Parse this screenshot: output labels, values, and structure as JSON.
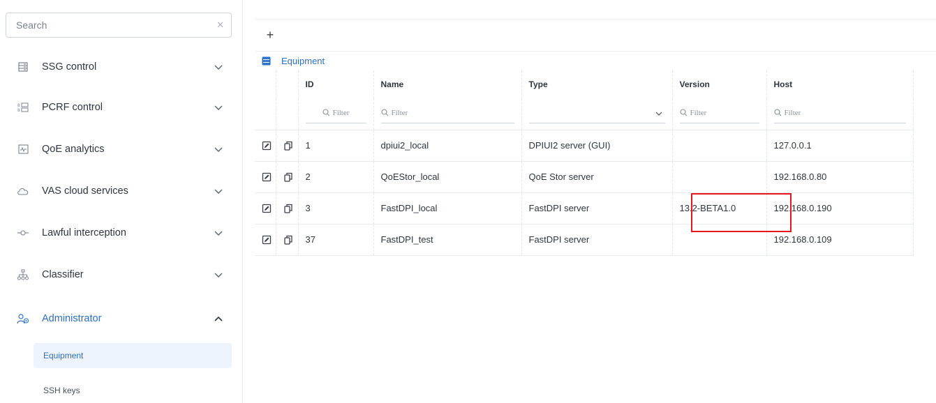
{
  "sidebar": {
    "search": {
      "placeholder": "Search",
      "value": ""
    },
    "items": [
      {
        "label": "SSG control",
        "icon": "server-rack-icon",
        "expanded": false
      },
      {
        "label": "PCRF control",
        "icon": "pcrf-icon",
        "expanded": false
      },
      {
        "label": "QoE analytics",
        "icon": "analytics-chart-icon",
        "expanded": false
      },
      {
        "label": "VAS cloud services",
        "icon": "cloud-icon",
        "expanded": false
      },
      {
        "label": "Lawful interception",
        "icon": "interception-icon",
        "expanded": false
      },
      {
        "label": "Classifier",
        "icon": "hierarchy-icon",
        "expanded": false
      },
      {
        "label": "Administrator",
        "icon": "admin-users-icon",
        "expanded": true
      }
    ],
    "subitems": [
      {
        "label": "Equipment",
        "selected": true
      },
      {
        "label": "SSH keys",
        "selected": false
      }
    ],
    "accent_color": "#2a6fc9"
  },
  "main": {
    "add_label": "+",
    "section_title": "Equipment",
    "columns": [
      "ID",
      "Name",
      "Type",
      "Version",
      "Host"
    ],
    "filter_placeholder": "Filter",
    "rows": [
      {
        "id": "1",
        "name": "dpiui2_local",
        "type": "DPIUI2 server (GUI)",
        "version": "",
        "host": "127.0.0.1"
      },
      {
        "id": "2",
        "name": "QoEStor_local",
        "type": "QoE Stor server",
        "version": "",
        "host": "192.168.0.80"
      },
      {
        "id": "3",
        "name": "FastDPI_local",
        "type": "FastDPI server",
        "version": "13.2-BETA1.0",
        "host": "192.168.0.190"
      },
      {
        "id": "37",
        "name": "FastDPI_test",
        "type": "FastDPI server",
        "version": "",
        "host": "192.168.0.109"
      }
    ],
    "highlight_color": "#e8161b"
  }
}
